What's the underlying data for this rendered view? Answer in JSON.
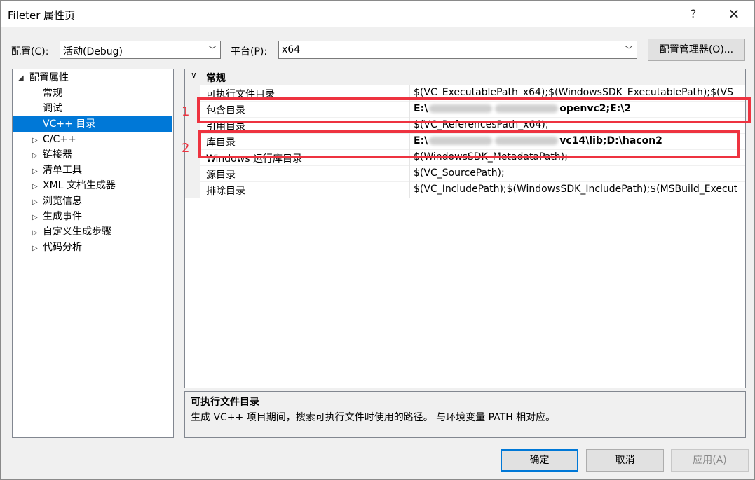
{
  "window": {
    "title": "Fileter 属性页",
    "help_glyph": "?",
    "close_glyph": "✕"
  },
  "toolbar": {
    "config_label": "配置(C):",
    "config_value": "活动(Debug)",
    "platform_label": "平台(P):",
    "platform_value": "x64",
    "config_manager_label": "配置管理器(O)..."
  },
  "tree": {
    "root": "配置属性",
    "items": [
      {
        "label": "常规",
        "expandable": false
      },
      {
        "label": "调试",
        "expandable": false
      },
      {
        "label": "VC++ 目录",
        "expandable": false,
        "selected": true
      },
      {
        "label": "C/C++",
        "expandable": true
      },
      {
        "label": "链接器",
        "expandable": true
      },
      {
        "label": "清单工具",
        "expandable": true
      },
      {
        "label": "XML 文档生成器",
        "expandable": true
      },
      {
        "label": "浏览信息",
        "expandable": true
      },
      {
        "label": "生成事件",
        "expandable": true
      },
      {
        "label": "自定义生成步骤",
        "expandable": true
      },
      {
        "label": "代码分析",
        "expandable": true
      }
    ]
  },
  "grid": {
    "section": "常规",
    "rows": [
      {
        "name": "可执行文件目录",
        "value": "$(VC_ExecutablePath_x64);$(WindowsSDK_ExecutablePath);$(VS"
      },
      {
        "name": "包含目录",
        "value_start": "E:\\",
        "value_end": "openvc2;E:\\2",
        "bold": true
      },
      {
        "name": "引用目录",
        "value": "$(VC_ReferencesPath_x64);"
      },
      {
        "name": "库目录",
        "value_start": "E:\\",
        "value_end": "vc14\\lib;D:\\hacon2",
        "bold": true
      },
      {
        "name": "Windows 运行库目录",
        "value": "$(WindowsSDK_MetadataPath);"
      },
      {
        "name": "源目录",
        "value": "$(VC_SourcePath);"
      },
      {
        "name": "排除目录",
        "value": "$(VC_IncludePath);$(WindowsSDK_IncludePath);$(MSBuild_Execut"
      }
    ]
  },
  "description": {
    "title": "可执行文件目录",
    "text": "生成 VC++ 项目期间，搜索可执行文件时使用的路径。 与环境变量 PATH 相对应。"
  },
  "buttons": {
    "ok": "确定",
    "cancel": "取消",
    "apply": "应用(A)"
  },
  "annotations": {
    "label1": "1",
    "label2": "2",
    "color": "#ee3340"
  }
}
